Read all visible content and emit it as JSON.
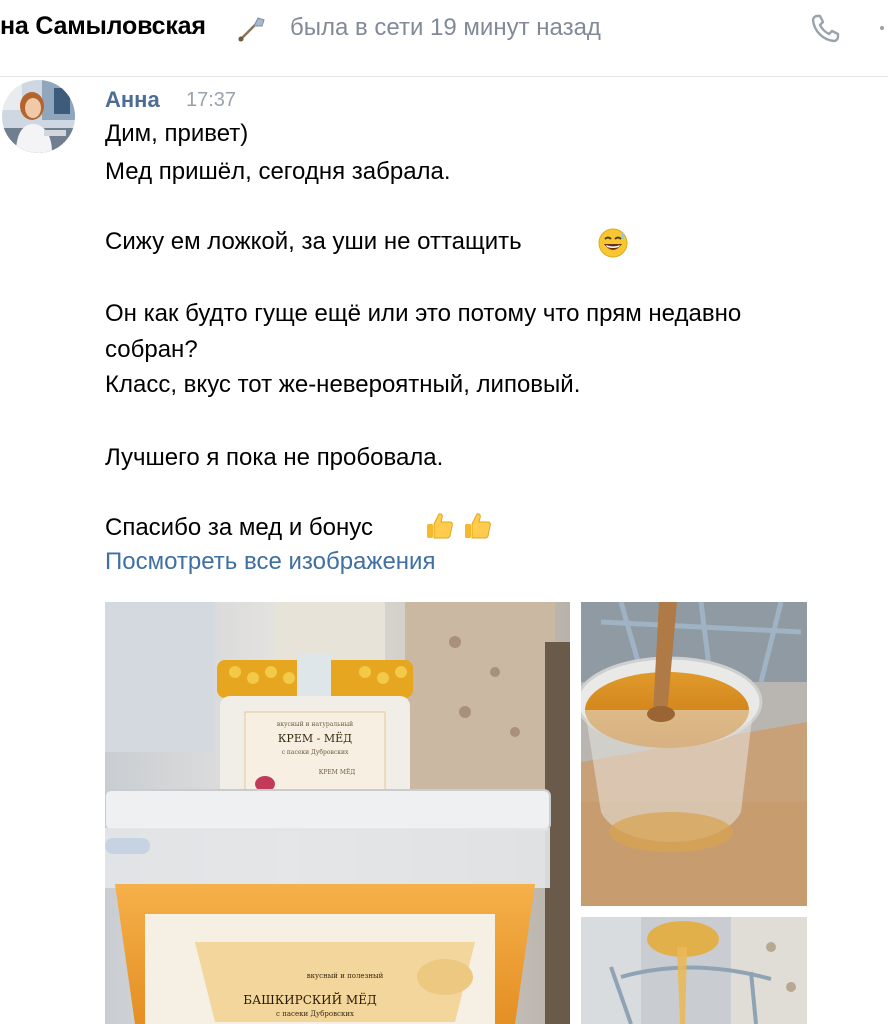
{
  "header": {
    "contact_name": "на Самыловская",
    "status": "была в сети 19 минут назад",
    "icons": {
      "name": "shovel-icon",
      "call": "phone-icon",
      "more": "more-icon"
    }
  },
  "message": {
    "author": "Анна",
    "time": "17:37",
    "lines": [
      "Дим, привет)",
      "Мед пришёл, сегодня забрала.",
      "Сижу ем ложкой, за уши не оттащить",
      "Он как будто гуще ещё или это потому что прям недавно",
      "собран?",
      "Класс, вкус тот же-невероятный, липовый.",
      "Лучшего я пока не пробовала.",
      "Спасибо за мед и бонус"
    ],
    "emojis": [
      "sweat-smile-emoji",
      "thumbs-up-emoji",
      "thumbs-up-emoji"
    ],
    "view_all_link": "Посмотреть все изображения"
  },
  "photos": {
    "main": {
      "jar_label_top": "вкусный и натуральный",
      "jar_title": "КРЕМ - МЁД",
      "jar_subtitle": "с пасеки Дубровских",
      "jar_small": "КРЕМ МЁД",
      "bucket_label_top": "вкусный и полезный",
      "bucket_title": "БАШКИРСКИЙ МЁД",
      "bucket_subtitle": "с пасеки Дубровских"
    }
  }
}
